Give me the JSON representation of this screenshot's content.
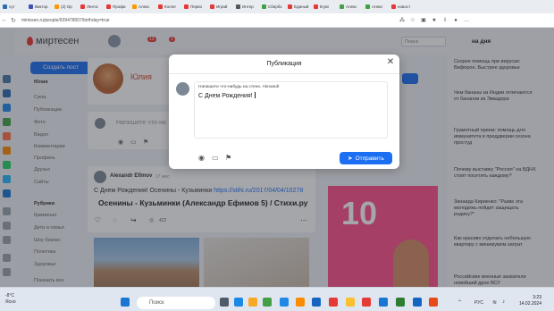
{
  "browser": {
    "tabs": [
      {
        "label": "сут",
        "color": "#2b6cb0"
      },
      {
        "label": "Виктор",
        "color": "#3f51b5"
      },
      {
        "label": "(3) Ор",
        "color": "#ff9800"
      },
      {
        "label": "Лента",
        "color": "#e53935"
      },
      {
        "label": "Профи",
        "color": "#e53935"
      },
      {
        "label": "Алекс",
        "color": "#ff9800"
      },
      {
        "label": "Колле",
        "color": "#e53935"
      },
      {
        "label": "Перво",
        "color": "#e53935"
      },
      {
        "label": "Играй",
        "color": "#e53935"
      },
      {
        "label": "Интер",
        "color": "#555555"
      },
      {
        "label": "Сбербз",
        "color": "#43a047"
      },
      {
        "label": "Единый",
        "color": "#e53935"
      },
      {
        "label": "kryat",
        "color": "#e53935"
      },
      {
        "label": "Алекс",
        "color": "#43a047"
      },
      {
        "label": "Алекс",
        "color": "#43a047"
      },
      {
        "label": "новост",
        "color": "#e53935"
      }
    ],
    "url": "mirtesen.ru/people/939478007/birthday=true",
    "back_icon": "arrow-left-icon",
    "accent": "#1c6ef2"
  },
  "site": {
    "logo": "миртесен",
    "notif_count_1": "13",
    "notif_count_2": "2",
    "search_placeholder": "Поиск",
    "news_header": "на дня",
    "create_post_label": "Создать пост",
    "nav": [
      {
        "label": "Юлия",
        "bold": true
      },
      {
        "label": "Сила",
        "bold": false
      },
      {
        "label": "Публикации",
        "bold": false
      },
      {
        "label": "Фото",
        "bold": false
      },
      {
        "label": "Видео",
        "bold": false
      },
      {
        "label": "Комментарии",
        "bold": false
      },
      {
        "label": "Профиль",
        "bold": false
      },
      {
        "label": "Друзья",
        "bold": false
      },
      {
        "label": "Сайты",
        "bold": false
      },
      {
        "label": "Рубрики",
        "bold": true
      },
      {
        "label": "Криминал",
        "bold": false
      },
      {
        "label": "Дети и семья",
        "bold": false
      },
      {
        "label": "Шоу бизнес",
        "bold": false
      },
      {
        "label": "Политика",
        "bold": false
      },
      {
        "label": "Здоровье",
        "bold": false
      },
      {
        "label": "Показать все",
        "bold": false
      }
    ],
    "profile_name": "Юлия",
    "composer_placeholder": "Напишите что-ни",
    "post": {
      "author": "Alexandr Efimov",
      "time": "17 мес",
      "text": "С Днем Рождения! Осенины - Кузьминки",
      "link": "https://stihi.ru/2017/04/04/10278",
      "title": "Осенины - Кузьминки (Александр Ефимов 5) / Стихи.ру",
      "views": "422"
    },
    "ad_number": "10",
    "news": [
      "Скорее помощь при вирусах: Виферон. Быстрее здоровье",
      "Чем бананы из Индии отличаются от бананов из Эквадора",
      "Грамотный прием: помощь для иммунитета в преддверии сезона простуд",
      "Почему выставку \"Россия\" на ВДНХ стоит посетить каждому?",
      "Зинаида Кириенко: \"Разве эта молодежь пойдет защищать родину?\"",
      "Как красиво отделать небольшую квартиру с минимумом затрат",
      "Российские военные захватили новейший дрон ВСУ"
    ]
  },
  "modal": {
    "title": "Публикация",
    "close_icon": "close-icon",
    "hint": "Напишите что-нибудь на стене, Alexandr",
    "input_value": "С Днем Рождения!",
    "send_label": "Отправить",
    "tools": [
      "camera-icon",
      "video-icon",
      "flag-icon"
    ]
  },
  "taskbar": {
    "weather_temp": "-8°C",
    "weather_desc": "Ясно",
    "search_placeholder": "Поиск",
    "lang": "РУС",
    "time": "3:23",
    "date": "14.02.2024"
  }
}
